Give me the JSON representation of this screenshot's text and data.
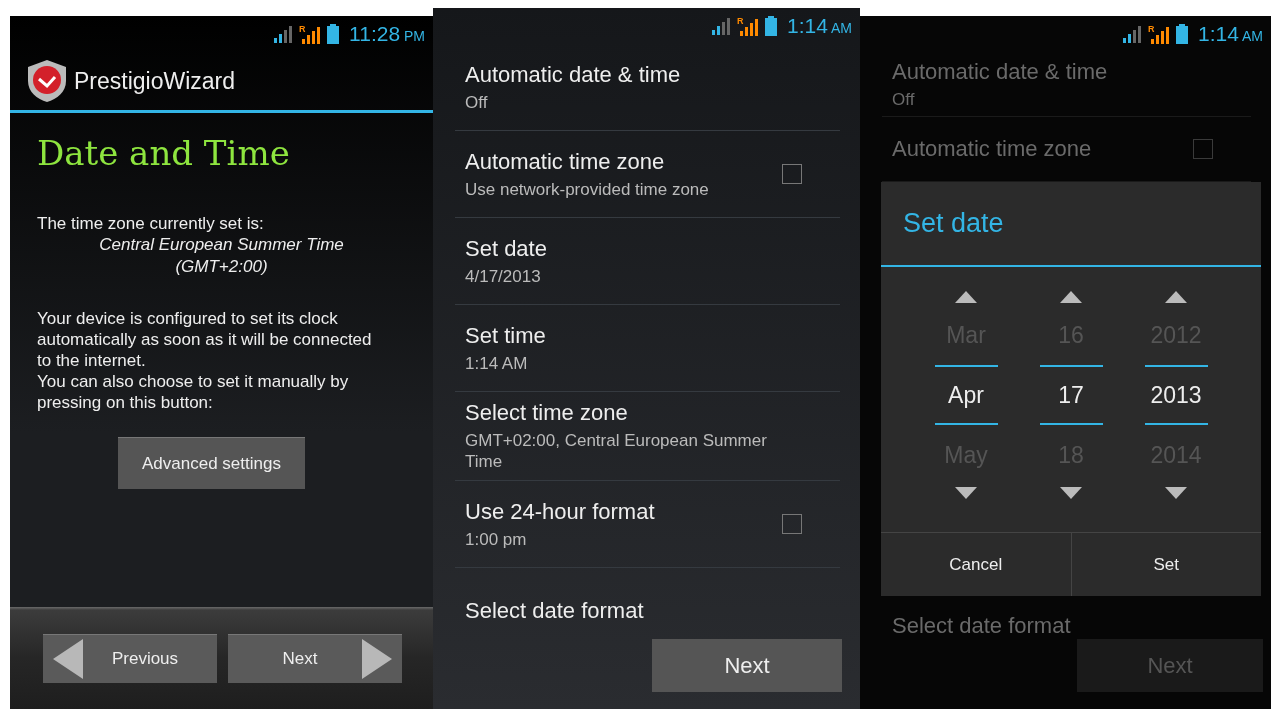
{
  "wizard_screen": {
    "status_bar": {
      "roaming_mark": "R",
      "time": "11:28",
      "period": "PM"
    },
    "app_bar": {
      "title": "PrestigioWizard"
    },
    "heading": "Date and Time",
    "timezone_label": "The time zone currently set is:",
    "timezone_lines": [
      "Central European Summer Time",
      "(GMT+2:00)"
    ],
    "paragraphs": [
      "Your device is configured to set its clock automatically as soon as it will be connected to the internet.",
      "You can also choose to set it manually by pressing on this button:"
    ],
    "advanced_button": "Advanced settings",
    "nav_buttons": [
      {
        "label": "Previous",
        "kind": "back"
      },
      {
        "label": "Next",
        "kind": "forward"
      }
    ]
  },
  "settings_screen": {
    "status_bar": {
      "roaming_mark": "R",
      "time": "1:14",
      "period": "AM"
    },
    "items": [
      {
        "title": "Automatic date & time",
        "subtitle": "Off",
        "kind": "plain"
      },
      {
        "title": "Automatic time zone",
        "subtitle": "Use network-provided time zone",
        "kind": "checkbox",
        "checked": false
      },
      {
        "title": "Set date",
        "subtitle": "4/17/2013",
        "kind": "plain"
      },
      {
        "title": "Set time",
        "subtitle": "1:14 AM",
        "kind": "plain"
      },
      {
        "title": "Select time zone",
        "subtitle": "GMT+02:00, Central European Summer Time",
        "kind": "plain"
      },
      {
        "title": "Use 24-hour format",
        "subtitle": "1:00 pm",
        "kind": "checkbox",
        "checked": false
      },
      {
        "title": "Select date format",
        "kind": "plain"
      }
    ],
    "next_button": "Next"
  },
  "dialog_screen": {
    "status_bar": {
      "roaming_mark": "R",
      "time": "1:14",
      "period": "AM"
    },
    "background_items": [
      {
        "title": "Automatic date & time",
        "subtitle": "Off",
        "kind": "plain"
      },
      {
        "title": "Automatic time zone",
        "kind": "checkbox",
        "checked": false
      }
    ],
    "bottom_item": {
      "title": "Select date format"
    },
    "next_button": "Next",
    "dialog": {
      "title": "Set date",
      "pickers": [
        {
          "previous": "Mar",
          "value": "Apr",
          "next": "May"
        },
        {
          "previous": "16",
          "value": "17",
          "next": "18"
        },
        {
          "previous": "2012",
          "value": "2013",
          "next": "2014"
        }
      ],
      "buttons": [
        "Cancel",
        "Set"
      ]
    }
  }
}
